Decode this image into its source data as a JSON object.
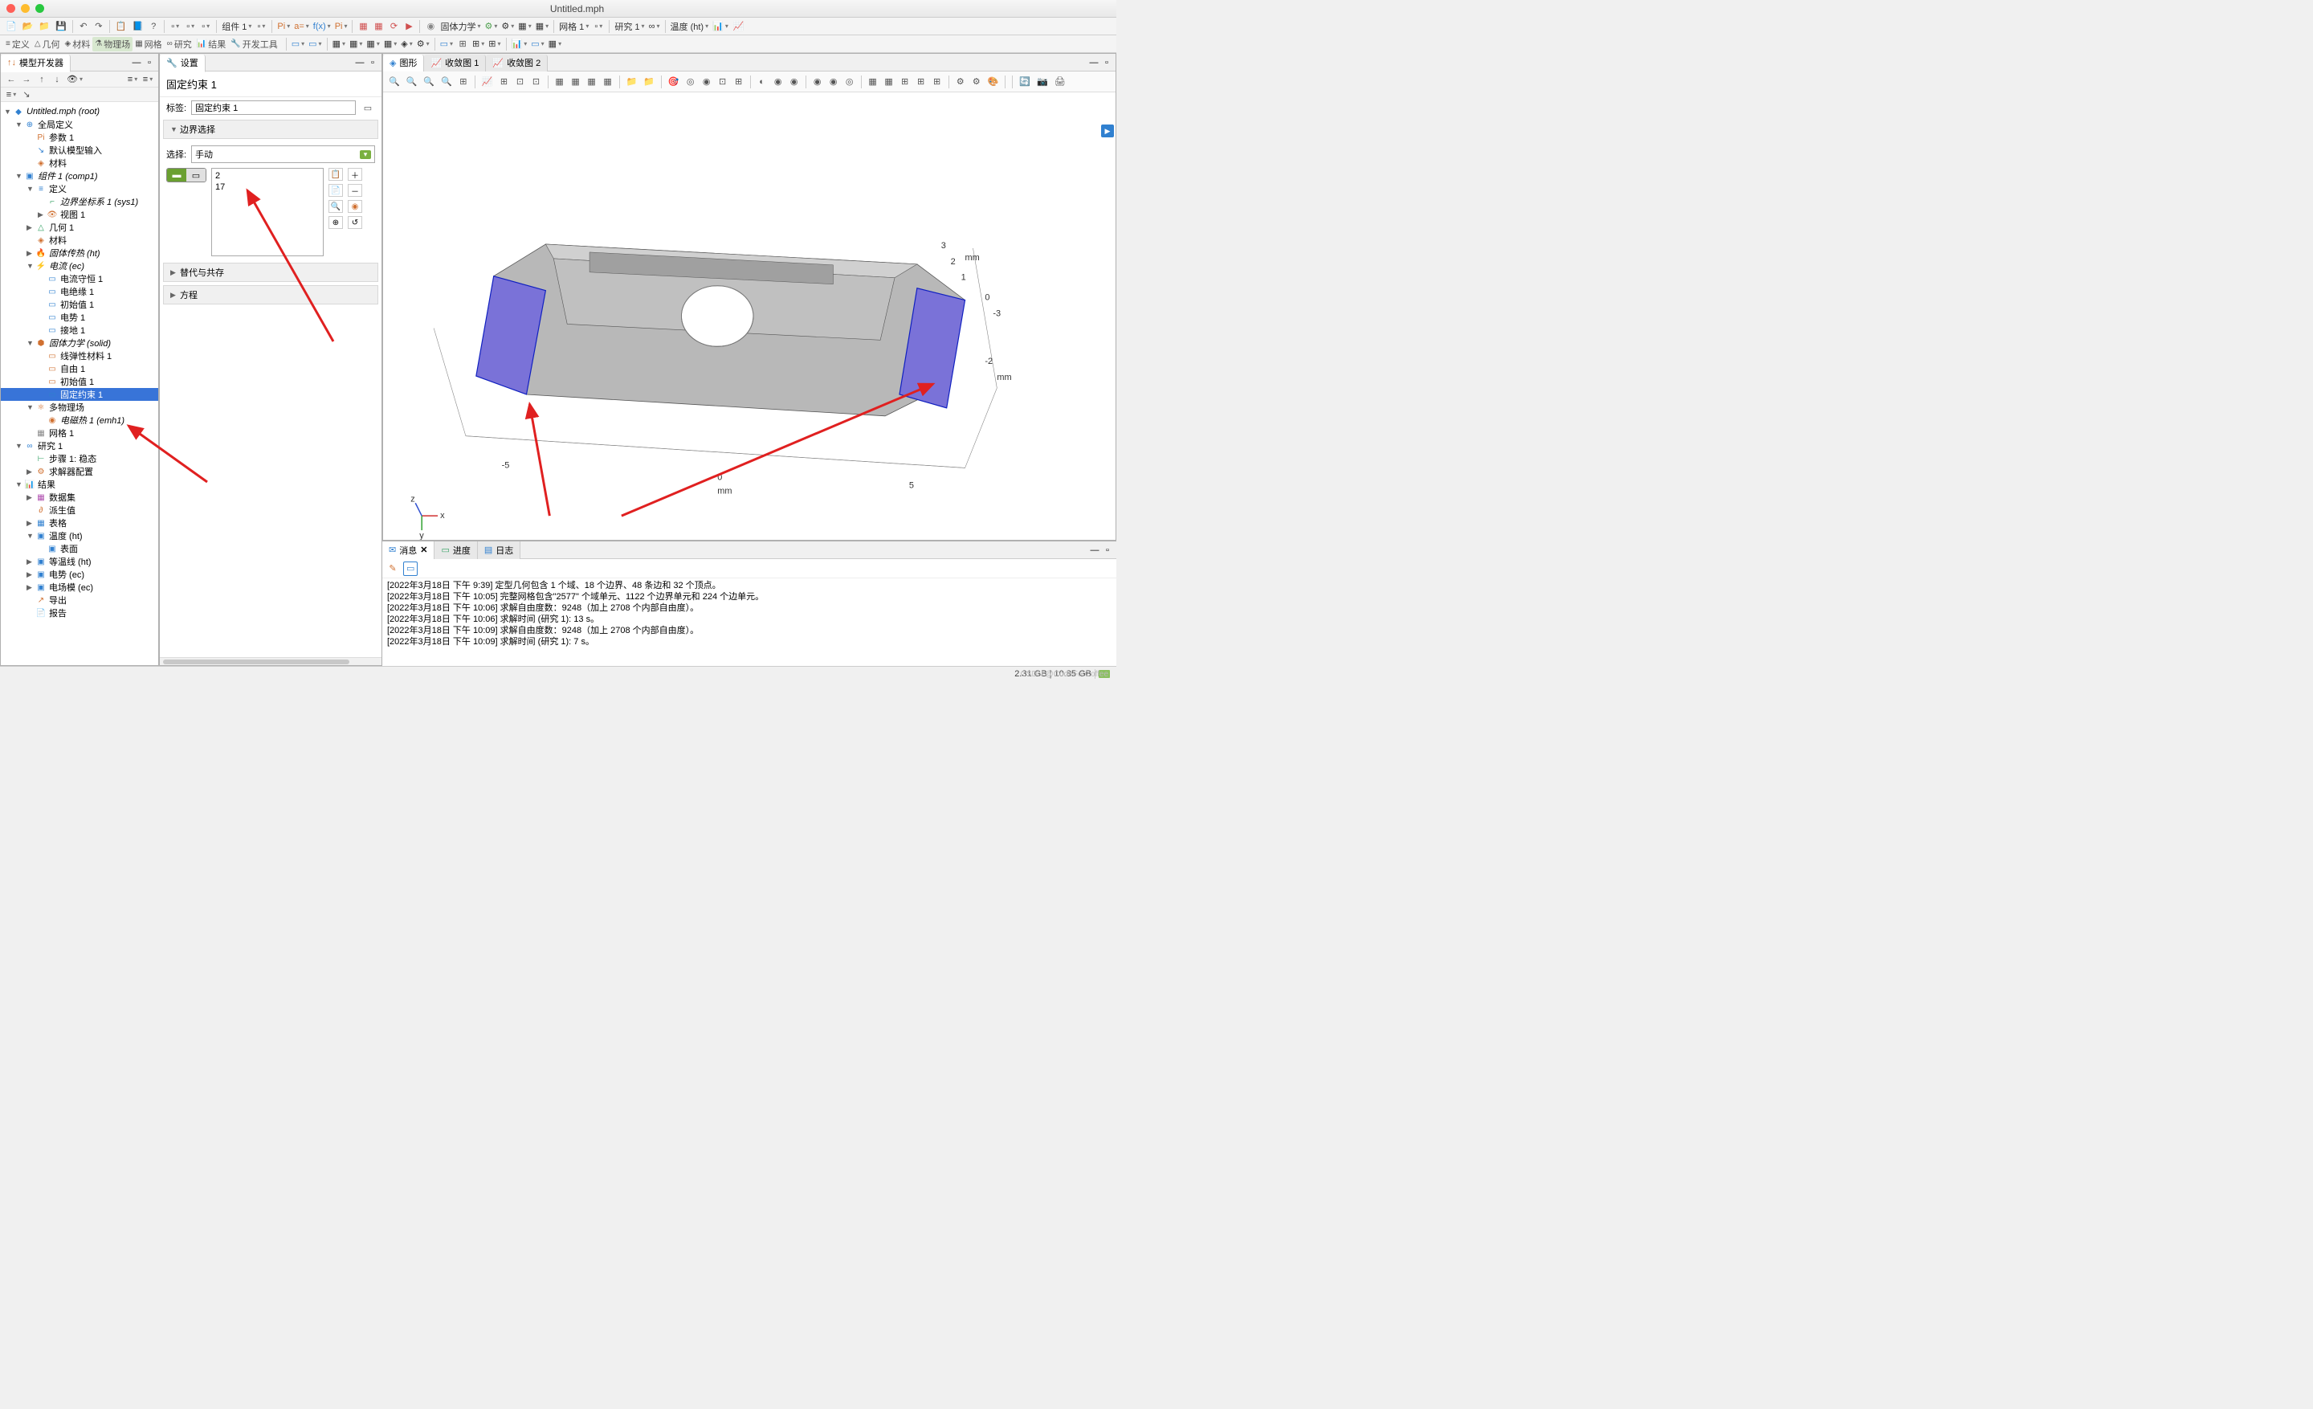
{
  "window": {
    "title": "Untitled.mph"
  },
  "toolbar1": {
    "groups": [
      [
        "📄",
        "📂",
        "📁",
        "💾"
      ],
      [
        "↶",
        "↷"
      ],
      [
        "📋",
        "📘",
        "?"
      ]
    ],
    "dropdowns": [
      "组件 1",
      "固体力学",
      "网格 1",
      "研究 1",
      "温度 (ht)"
    ],
    "btns_mid": [
      "Pi",
      "a=",
      "f(x)",
      "Pi"
    ],
    "btns_after": [
      "▦",
      "▦",
      "⟳",
      "▶"
    ],
    "btns_physics": [
      "◉",
      "⚙"
    ],
    "btns_net": [
      "⚙",
      "▦",
      "▦",
      "▦"
    ],
    "btns_study": [
      "📊",
      "📈"
    ]
  },
  "toolbar2": {
    "items": [
      {
        "glyph": "≡",
        "label": "定义"
      },
      {
        "glyph": "△",
        "label": "几何"
      },
      {
        "glyph": "◈",
        "label": "材料"
      },
      {
        "glyph": "⚗",
        "label": "物理场"
      },
      {
        "glyph": "▦",
        "label": "网格"
      },
      {
        "glyph": "∞",
        "label": "研究"
      },
      {
        "glyph": "📊",
        "label": "结果"
      },
      {
        "glyph": "🔧",
        "label": "开发工具"
      }
    ]
  },
  "panels": {
    "model_builder": {
      "title": "模型开发器"
    },
    "settings": {
      "title": "设置"
    },
    "graphics_tabs": [
      "图形",
      "收敛图 1",
      "收敛图 2"
    ],
    "messages_tabs": [
      "消息",
      "进度",
      "日志"
    ]
  },
  "tree": [
    {
      "d": 0,
      "t": "▼",
      "i": "◆",
      "c": "#3080d0",
      "l": "Untitled.mph (root)",
      "it": true
    },
    {
      "d": 1,
      "t": "▼",
      "i": "⊕",
      "c": "#3080d0",
      "l": "全局定义"
    },
    {
      "d": 2,
      "t": "",
      "i": "Pi",
      "c": "#d07030",
      "l": "参数 1"
    },
    {
      "d": 2,
      "t": "",
      "i": "↘",
      "c": "#3080d0",
      "l": "默认模型输入"
    },
    {
      "d": 2,
      "t": "",
      "i": "◈",
      "c": "#d07030",
      "l": "材料"
    },
    {
      "d": 1,
      "t": "▼",
      "i": "▣",
      "c": "#3080d0",
      "l": "组件 1 (comp1)",
      "it": true
    },
    {
      "d": 2,
      "t": "▼",
      "i": "≡",
      "c": "#3080d0",
      "l": "定义"
    },
    {
      "d": 3,
      "t": "",
      "i": "⌐",
      "c": "#30a060",
      "l": "边界坐标系 1 (sys1)",
      "it": true
    },
    {
      "d": 3,
      "t": "▶",
      "i": "👁",
      "c": "#d07030",
      "l": "视图 1"
    },
    {
      "d": 2,
      "t": "▶",
      "i": "△",
      "c": "#30a060",
      "l": "几何 1"
    },
    {
      "d": 2,
      "t": "",
      "i": "◈",
      "c": "#d07030",
      "l": "材料"
    },
    {
      "d": 2,
      "t": "▶",
      "i": "🔥",
      "c": "#d07030",
      "l": "固体传热 (ht)",
      "it": true
    },
    {
      "d": 2,
      "t": "▼",
      "i": "⚡",
      "c": "#d07030",
      "l": "电流 (ec)",
      "it": true
    },
    {
      "d": 3,
      "t": "",
      "i": "▭",
      "c": "#3080d0",
      "l": "电流守恒 1"
    },
    {
      "d": 3,
      "t": "",
      "i": "▭",
      "c": "#3080d0",
      "l": "电绝缘 1"
    },
    {
      "d": 3,
      "t": "",
      "i": "▭",
      "c": "#3080d0",
      "l": "初始值 1"
    },
    {
      "d": 3,
      "t": "",
      "i": "▭",
      "c": "#3080d0",
      "l": "电势 1"
    },
    {
      "d": 3,
      "t": "",
      "i": "▭",
      "c": "#3080d0",
      "l": "接地 1"
    },
    {
      "d": 2,
      "t": "▼",
      "i": "⬢",
      "c": "#d07030",
      "l": "固体力学 (solid)",
      "it": true
    },
    {
      "d": 3,
      "t": "",
      "i": "▭",
      "c": "#d07030",
      "l": "线弹性材料 1"
    },
    {
      "d": 3,
      "t": "",
      "i": "▭",
      "c": "#d07030",
      "l": "自由 1"
    },
    {
      "d": 3,
      "t": "",
      "i": "▭",
      "c": "#d07030",
      "l": "初始值 1"
    },
    {
      "d": 3,
      "t": "",
      "i": "▭",
      "c": "#3080d0",
      "l": "固定约束 1",
      "sel": true
    },
    {
      "d": 2,
      "t": "▼",
      "i": "⚛",
      "c": "#d07030",
      "l": "多物理场"
    },
    {
      "d": 3,
      "t": "",
      "i": "◉",
      "c": "#d07030",
      "l": "电磁热 1 (emh1)",
      "it": true
    },
    {
      "d": 2,
      "t": "",
      "i": "▦",
      "c": "#888",
      "l": "网格 1"
    },
    {
      "d": 1,
      "t": "▼",
      "i": "∞",
      "c": "#3080d0",
      "l": "研究 1"
    },
    {
      "d": 2,
      "t": "",
      "i": "⊢",
      "c": "#30a060",
      "l": "步骤 1: 稳态"
    },
    {
      "d": 2,
      "t": "▶",
      "i": "⚙",
      "c": "#d07030",
      "l": "求解器配置"
    },
    {
      "d": 1,
      "t": "▼",
      "i": "📊",
      "c": "#d07030",
      "l": "结果"
    },
    {
      "d": 2,
      "t": "▶",
      "i": "▦",
      "c": "#b050b0",
      "l": "数据集"
    },
    {
      "d": 2,
      "t": "",
      "i": "∂",
      "c": "#d07030",
      "l": "派生值"
    },
    {
      "d": 2,
      "t": "▶",
      "i": "▦",
      "c": "#3080d0",
      "l": "表格"
    },
    {
      "d": 2,
      "t": "▼",
      "i": "▣",
      "c": "#3080d0",
      "l": "温度 (ht)"
    },
    {
      "d": 3,
      "t": "",
      "i": "▣",
      "c": "#3080d0",
      "l": "表面"
    },
    {
      "d": 2,
      "t": "▶",
      "i": "▣",
      "c": "#3080d0",
      "l": "等温线 (ht)"
    },
    {
      "d": 2,
      "t": "▶",
      "i": "▣",
      "c": "#3080d0",
      "l": "电势 (ec)"
    },
    {
      "d": 2,
      "t": "▶",
      "i": "▣",
      "c": "#3080d0",
      "l": "电场模 (ec)"
    },
    {
      "d": 2,
      "t": "",
      "i": "↗",
      "c": "#d07030",
      "l": "导出"
    },
    {
      "d": 2,
      "t": "",
      "i": "📄",
      "c": "#d050a0",
      "l": "报告"
    }
  ],
  "settings": {
    "header": "固定约束 1",
    "label_tag": "标签:",
    "tag_value": "固定约束 1",
    "section_boundary": "边界选择",
    "sel_label": "选择:",
    "sel_mode": "手动",
    "sel_items": [
      "2",
      "17"
    ],
    "section_override": "替代与共存",
    "section_eq": "方程"
  },
  "graphics": {
    "axis_unit": "mm",
    "x_ticks": [
      "-5",
      "0",
      "5"
    ],
    "y_ticks": [
      "3",
      "2",
      "1",
      "0",
      "-3",
      "-2"
    ]
  },
  "gtoolbar": [
    "🔍",
    "🔍",
    "🔍",
    "🔍",
    "⊞",
    "|",
    "📈",
    "⊞",
    "⊡",
    "⊡",
    "|",
    "▦",
    "▦",
    "▦",
    "▦",
    "|",
    "📁",
    "📁",
    "|",
    "🎯",
    "◎",
    "◉",
    "⊡",
    "⊞",
    "|",
    "◐",
    "◉",
    "◉",
    "|",
    "◉",
    "◉",
    "◎",
    "|",
    "▦",
    "▦",
    "⊞",
    "⊞",
    "⊞",
    "|",
    "⚙",
    "⚙",
    "🎨",
    "|",
    "|",
    "🔄",
    "📷",
    "🖨"
  ],
  "messages": [
    "[2022年3月18日 下午 9:39] 定型几何包含 1 个域、18 个边界、48 条边和 32 个顶点。",
    "[2022年3月18日 下午 10:05] 完整网格包含\"2577\" 个域单元、1122 个边界单元和 224 个边单元。",
    "[2022年3月18日 下午 10:06] 求解自由度数：9248（加上 2708 个内部自由度）。",
    "[2022年3月18日 下午 10:06] 求解时间 (研究 1): 13 s。",
    "[2022年3月18日 下午 10:09] 求解自由度数：9248（加上 2708 个内部自由度）。",
    "[2022年3月18日 下午 10:09] 求解时间 (研究 1): 7 s。"
  ],
  "status": {
    "mem": "2.31 GB | 10.85 GB"
  },
  "watermark": "CSDN @CodeForCoffee"
}
